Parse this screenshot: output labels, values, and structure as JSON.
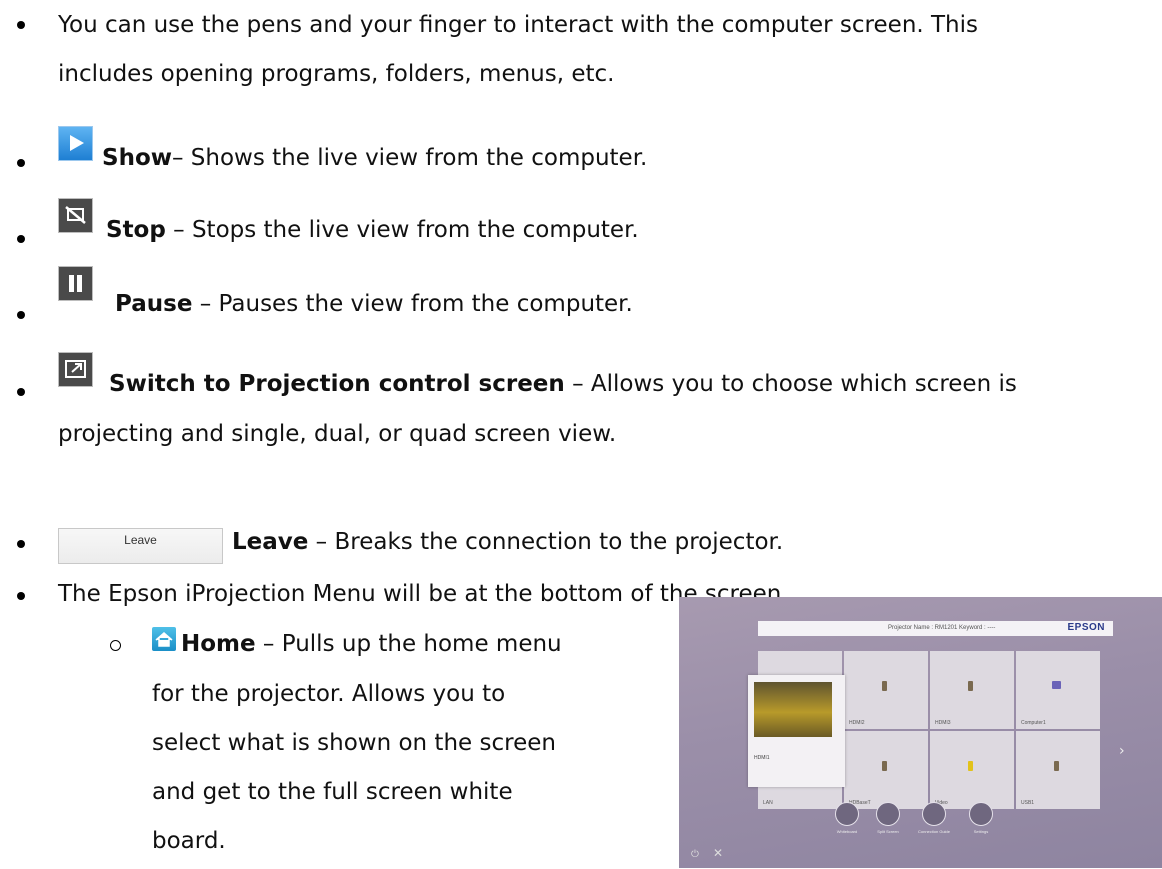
{
  "intro": {
    "line1": "You can use the pens and your finger to interact with the computer screen. This",
    "line2": "includes opening programs, folders, menus, etc."
  },
  "items": [
    {
      "icon": "show-icon",
      "bold": "Show",
      "text": "– Shows the live view from the computer."
    },
    {
      "icon": "stop-icon",
      "bold": "Stop",
      "text": " – Stops the live view from the computer."
    },
    {
      "icon": "pause-icon",
      "bold": "Pause",
      "text": " – Pauses the view from the computer."
    },
    {
      "icon": "switch-screen-icon",
      "bold": "Switch to Projection control screen",
      "text": " – Allows you to choose which screen is",
      "text2": "projecting and single, dual, or quad screen view."
    },
    {
      "icon": "leave-button",
      "bold": "Leave",
      "text": " – Breaks the connection to the projector."
    }
  ],
  "leave_button_label": "Leave",
  "menu_line": "The Epson iProjection Menu will be at the bottom of the screen.",
  "home": {
    "bold": "Home",
    "lines": [
      " – Pulls up the home menu",
      "for the projector. Allows you to",
      "select what is shown on the screen",
      "and get to the full screen white",
      "board."
    ]
  },
  "photo": {
    "projector_name": "Projector Name : RM1201     Keyword : ----",
    "brand": "EPSON",
    "tiles": [
      "HDMI1",
      "HDMI2",
      "HDMI3",
      "Computer1",
      "LAN",
      "HDBaseT",
      "Video",
      "USB1"
    ],
    "dock": [
      "Whiteboard",
      "Split Screen",
      "Connection Guide",
      "Settings"
    ]
  }
}
